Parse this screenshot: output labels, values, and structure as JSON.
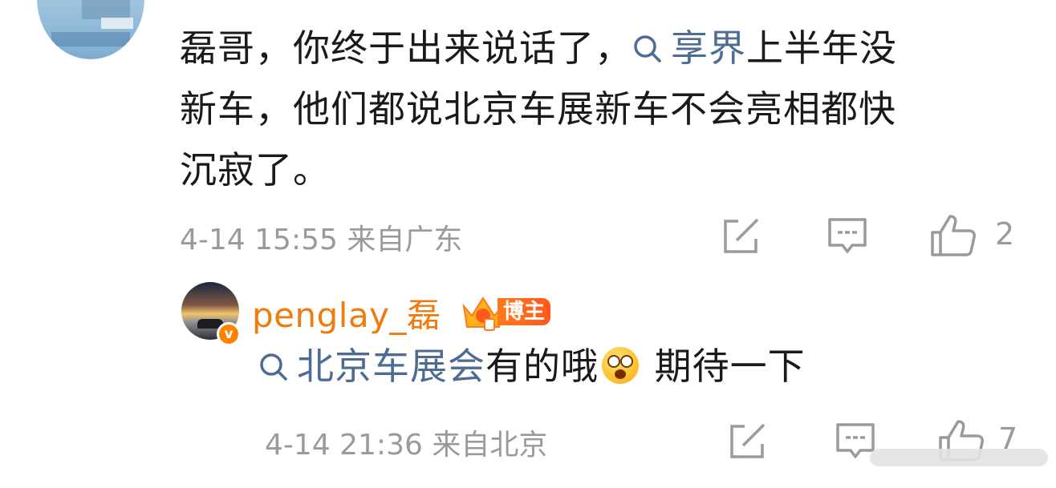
{
  "comment": {
    "text_line1_before": "磊哥，你终于出来说话了，",
    "topic": "享界",
    "text_line1_after": "上半年没",
    "text_line2": "新车，他们都说北京车展新车不会亮相都快",
    "text_line3": "沉寂了。",
    "time": "4-14 15:55",
    "location": "来自广东",
    "likes": "2"
  },
  "reply": {
    "username": "penglay_磊",
    "badge_label": "博主",
    "topic": "北京车展会",
    "text_after_topic": "有的哦",
    "text_after_emoji": " 期待一下",
    "time": "4-14 21:36",
    "location": "来自北京",
    "likes": "7"
  },
  "icons": {
    "share": "share-icon",
    "comment": "comment-icon",
    "like": "thumbs-up-icon",
    "topic_search": "search-icon",
    "verified": "verified-icon",
    "emoji": "drooling-face-emoji"
  },
  "colors": {
    "topic_link": "#4e6b93",
    "username": "#f07b10",
    "meta_gray": "#9a9a9a",
    "badge": "#ff6a1a"
  }
}
